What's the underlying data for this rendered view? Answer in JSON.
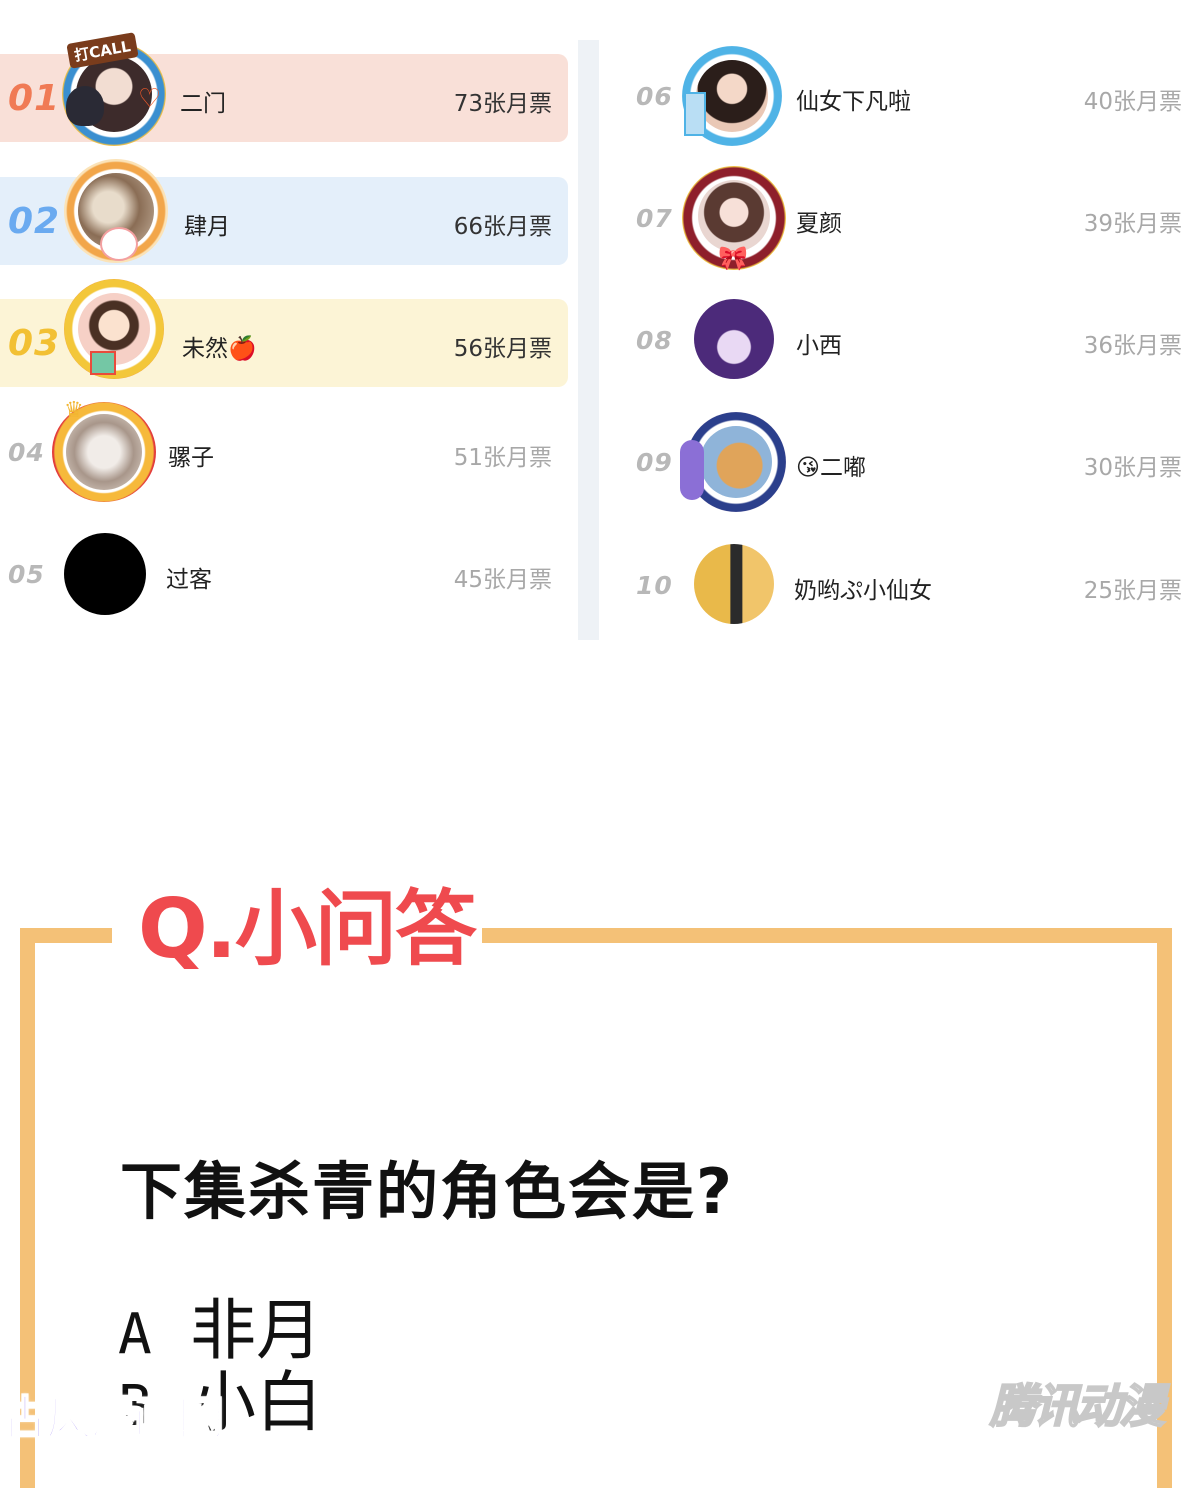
{
  "ranking": {
    "left": [
      {
        "rank": "01",
        "name": "二门",
        "votes": "73张月票"
      },
      {
        "rank": "02",
        "name": "肆月",
        "votes": "66张月票"
      },
      {
        "rank": "03",
        "name": "未然🍎",
        "votes": "56张月票"
      },
      {
        "rank": "04",
        "name": "骡子",
        "votes": "51张月票"
      },
      {
        "rank": "05",
        "name": "过客",
        "votes": "45张月票"
      }
    ],
    "right": [
      {
        "rank": "06",
        "name": "仙女下凡啦",
        "votes": "40张月票"
      },
      {
        "rank": "07",
        "name": "夏颜",
        "votes": "39张月票"
      },
      {
        "rank": "08",
        "name": "小西",
        "votes": "36张月票"
      },
      {
        "rank": "09",
        "name": "😘二嘟",
        "votes": "30张月票"
      },
      {
        "rank": "10",
        "name": "奶哟ぷ小仙女",
        "votes": "25张月票"
      }
    ],
    "avatar_badge_text": "打CALL"
  },
  "colors": {
    "rank1_bg": "#f9e0d8",
    "rank1_num": "#f07a55",
    "rank2_bg": "#e4effa",
    "rank2_num": "#6aaaf0",
    "rank3_bg": "#fcf4d6",
    "rank3_num": "#f2c033",
    "rank_other_num": "#b8b8b8",
    "votes_top": "#333333",
    "votes_other": "#a8a8a8",
    "qa_frame": "#f4c177",
    "qa_title": "#ef4a4e"
  },
  "qa": {
    "title": "Q.小问答",
    "question": "下集杀青的角色会是?",
    "options": [
      {
        "letter": "A",
        "text": "非月"
      },
      {
        "letter": "B",
        "text": "小白"
      }
    ]
  },
  "watermarks": {
    "left": "古风漫画网",
    "right": "腾讯动漫"
  }
}
